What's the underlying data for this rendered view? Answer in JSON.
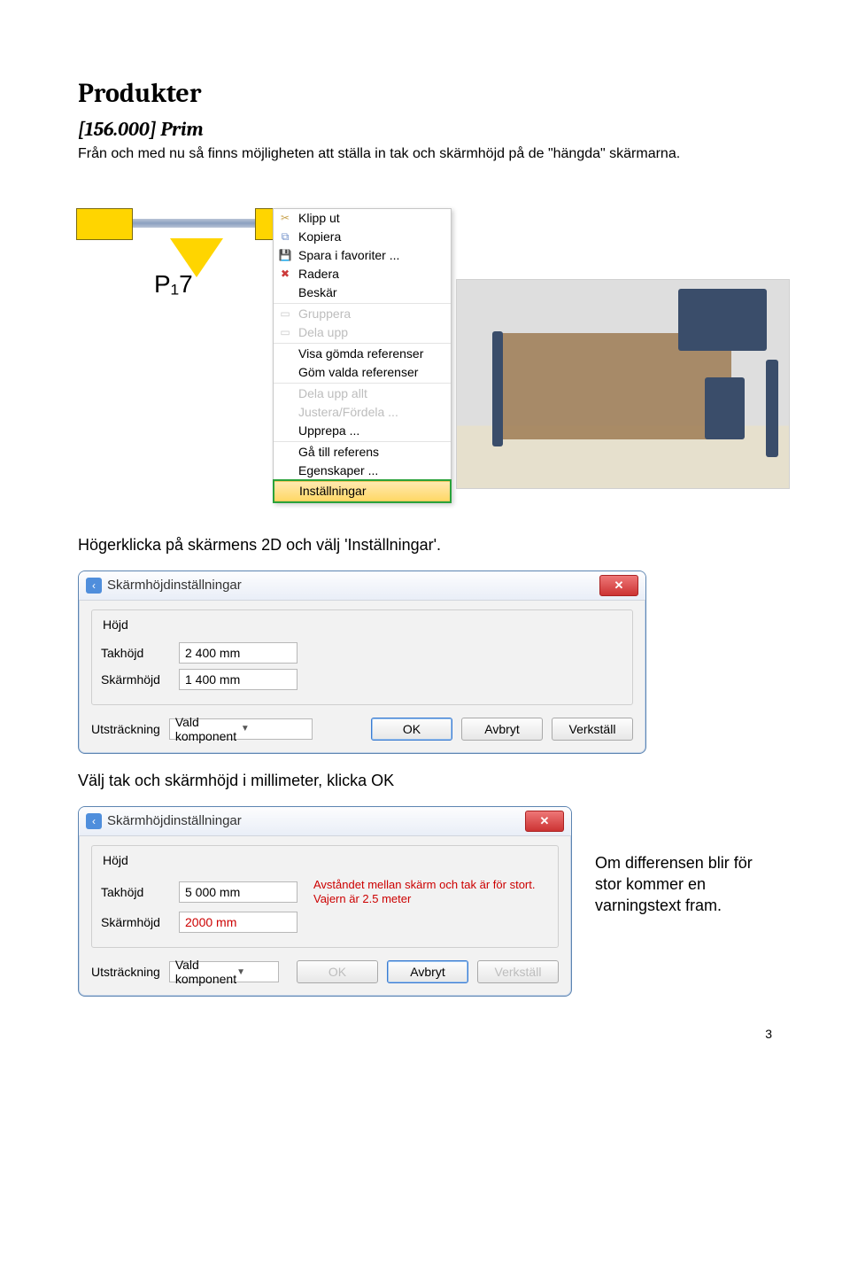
{
  "heading1": "Produkter",
  "heading2": "[156.000] Prim",
  "intro": "Från och med nu så finns möjligheten att ställa in tak och skärmhöjd på de \"hängda\" skärmarna.",
  "plan_label": "P₁7",
  "context_menu": {
    "items": [
      {
        "label": "Klipp ut",
        "icon": "✂",
        "icon_color": "#c8a24c"
      },
      {
        "label": "Kopiera",
        "icon": "⧉",
        "icon_color": "#6c8cc7"
      },
      {
        "label": "Spara i favoriter ...",
        "icon": "💾",
        "icon_color": "#3a8b2f"
      },
      {
        "label": "Radera",
        "icon": "✖",
        "icon_color": "#cc3a3a"
      },
      {
        "label": "Beskär",
        "icon": ""
      }
    ],
    "group2": [
      {
        "label": "Gruppera",
        "icon": "▭",
        "disabled": true
      },
      {
        "label": "Dela upp",
        "icon": "▭",
        "disabled": true
      }
    ],
    "group3": [
      {
        "label": "Visa gömda referenser"
      },
      {
        "label": "Göm valda referenser"
      }
    ],
    "group4": [
      {
        "label": "Dela upp allt",
        "disabled": true
      },
      {
        "label": "Justera/Fördela ...",
        "disabled": true
      },
      {
        "label": "Upprepa ..."
      }
    ],
    "group5": [
      {
        "label": "Gå till referens"
      },
      {
        "label": "Egenskaper ..."
      }
    ],
    "highlight": {
      "label": "Inställningar"
    }
  },
  "caption1": "Högerklicka på skärmens 2D och välj 'Inställningar'.",
  "dialog1": {
    "title": "Skärmhöjdinställningar",
    "legend": "Höjd",
    "takhojd_label": "Takhöjd",
    "takhojd_value": "2 400 mm",
    "skarmhojd_label": "Skärmhöjd",
    "skarmhojd_value": "1 400 mm",
    "ext_label": "Utsträckning",
    "ext_value": "Vald komponent",
    "ok": "OK",
    "cancel": "Avbryt",
    "apply": "Verkställ"
  },
  "caption2": "Välj tak och skärmhöjd i millimeter, klicka OK",
  "dialog2": {
    "title": "Skärmhöjdinställningar",
    "legend": "Höjd",
    "takhojd_label": "Takhöjd",
    "takhojd_value": "5 000 mm",
    "skarmhojd_label": "Skärmhöjd",
    "skarmhojd_value": "2000 mm",
    "warn_line1": "Avståndet mellan skärm och tak är för stort.",
    "warn_line2": "Vajern är 2.5 meter",
    "ext_label": "Utsträckning",
    "ext_value": "Vald komponent",
    "ok": "OK",
    "cancel": "Avbryt",
    "apply": "Verkställ"
  },
  "side_note": "Om differensen blir för stor kommer en varningstext fram.",
  "page_number": "3"
}
